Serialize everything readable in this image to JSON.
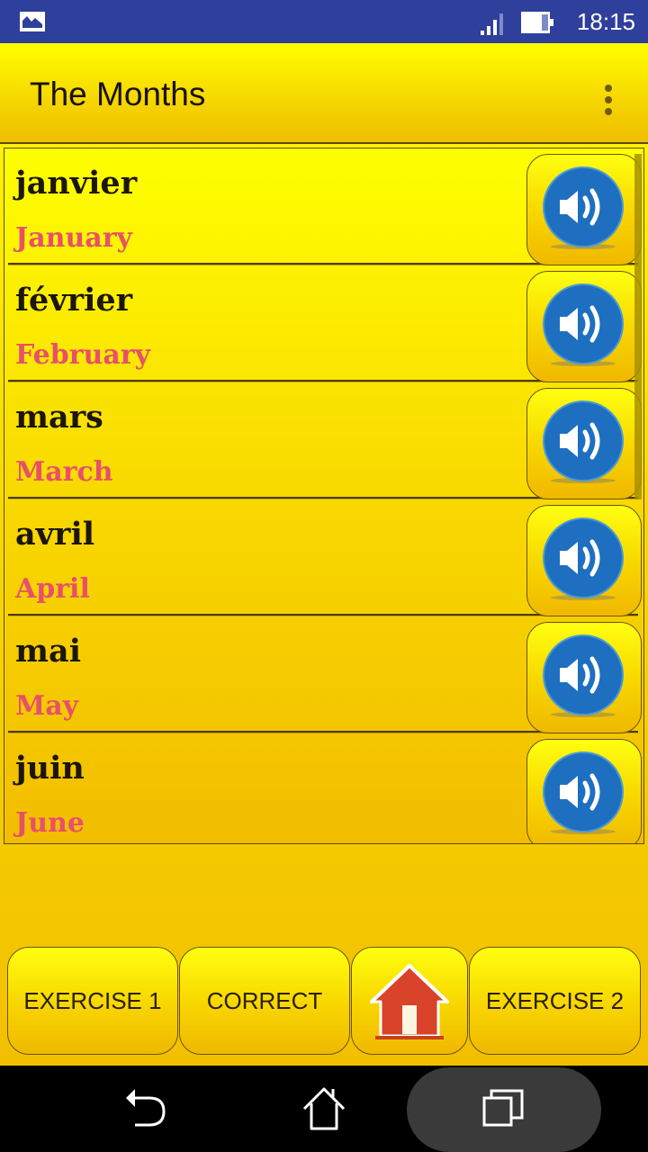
{
  "status_bar": {
    "notification_icon": "image-icon",
    "signal_icon": "signal-icon",
    "battery_icon": "battery-icon",
    "time": "18:15"
  },
  "app_bar": {
    "title": "The Months",
    "menu_icon": "more-vert-icon"
  },
  "months": [
    {
      "french": "janvier",
      "english": "January",
      "icon": "speaker-icon"
    },
    {
      "french": "février",
      "english": "February",
      "icon": "speaker-icon"
    },
    {
      "french": "mars",
      "english": "March",
      "icon": "speaker-icon"
    },
    {
      "french": "avril",
      "english": "April",
      "icon": "speaker-icon"
    },
    {
      "french": "mai",
      "english": "May",
      "icon": "speaker-icon"
    },
    {
      "french": "juin",
      "english": "June",
      "icon": "speaker-icon"
    }
  ],
  "bottom_buttons": {
    "exercise1": "EXERCISE 1",
    "correct": "CORRECT",
    "home_icon": "home-icon",
    "exercise2": "EXERCISE 2"
  },
  "nav_bar": {
    "back": "back-icon",
    "home": "home-outline-icon",
    "recents": "recents-icon"
  },
  "colors": {
    "status_bar": "#2e3f9c",
    "french_text": "#1c160a",
    "english_text": "#e8506a",
    "speaker_blue": "#1e6fbf",
    "home_red": "#d8432a"
  }
}
